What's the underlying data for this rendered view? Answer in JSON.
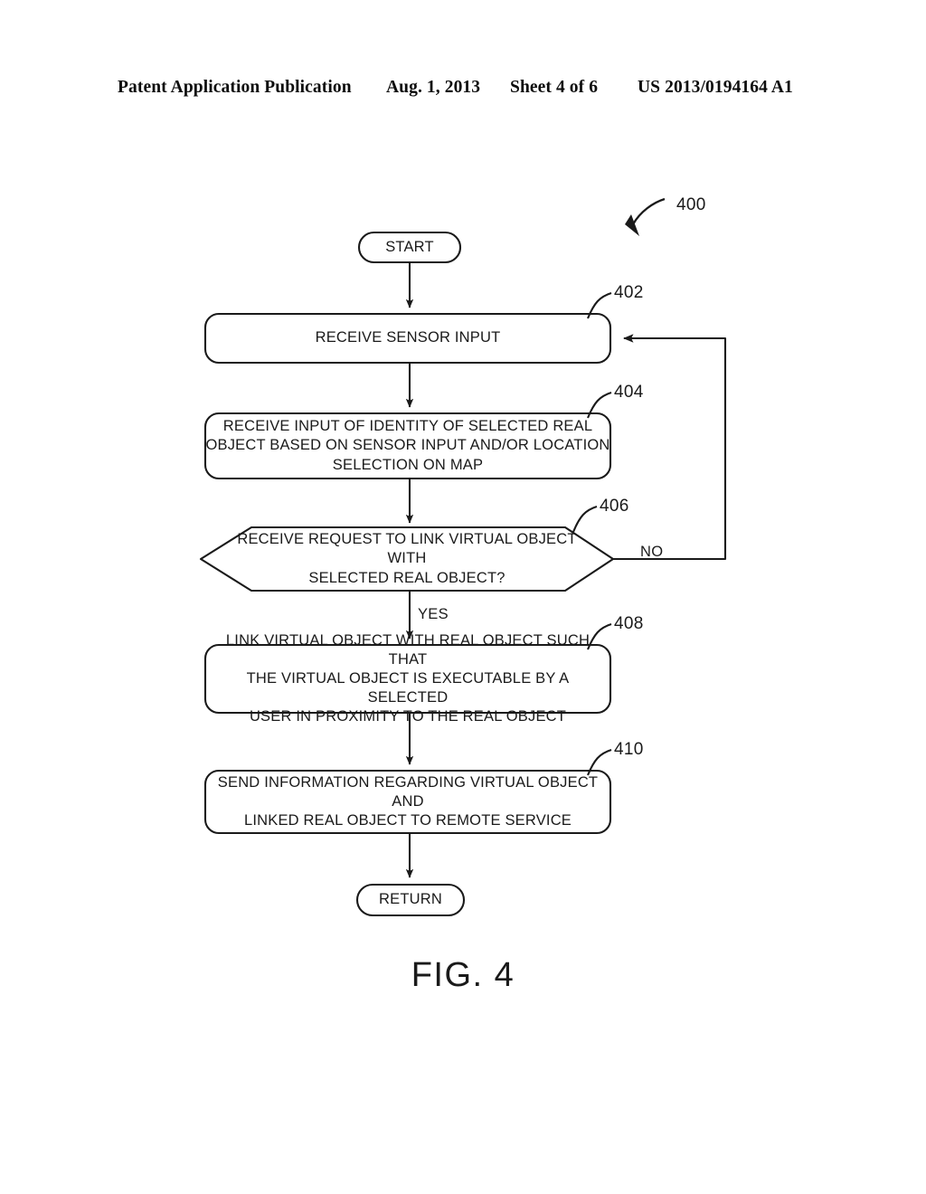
{
  "header": {
    "publication": "Patent Application Publication",
    "date": "Aug. 1, 2013",
    "sheet": "Sheet 4 of 6",
    "patent_number": "US 2013/0194164 A1"
  },
  "figure": {
    "caption": "FIG. 4",
    "diagram_ref": "400",
    "type": "flowchart"
  },
  "nodes": {
    "start": {
      "label": "START",
      "shape": "terminal"
    },
    "step_402": {
      "ref": "402",
      "label": "RECEIVE SENSOR INPUT",
      "shape": "process"
    },
    "step_404": {
      "ref": "404",
      "label": "RECEIVE INPUT OF IDENTITY OF SELECTED REAL\nOBJECT BASED ON SENSOR INPUT AND/OR LOCATION\nSELECTION ON MAP",
      "shape": "process"
    },
    "decision_406": {
      "ref": "406",
      "label": "RECEIVE REQUEST TO LINK VIRTUAL OBJECT WITH\nSELECTED REAL OBJECT?",
      "shape": "decision"
    },
    "step_408": {
      "ref": "408",
      "label": "LINK VIRTUAL OBJECT WITH REAL OBJECT SUCH THAT\nTHE VIRTUAL OBJECT IS EXECUTABLE BY A SELECTED\nUSER IN PROXIMITY TO THE REAL OBJECT",
      "shape": "process"
    },
    "step_410": {
      "ref": "410",
      "label": "SEND INFORMATION REGARDING VIRTUAL OBJECT AND\nLINKED REAL OBJECT TO REMOTE SERVICE",
      "shape": "process"
    },
    "return": {
      "label": "RETURN",
      "shape": "terminal"
    }
  },
  "branches": {
    "yes": "YES",
    "no": "NO"
  },
  "colors": {
    "ink": "#1a1a1a",
    "page": "#ffffff"
  }
}
